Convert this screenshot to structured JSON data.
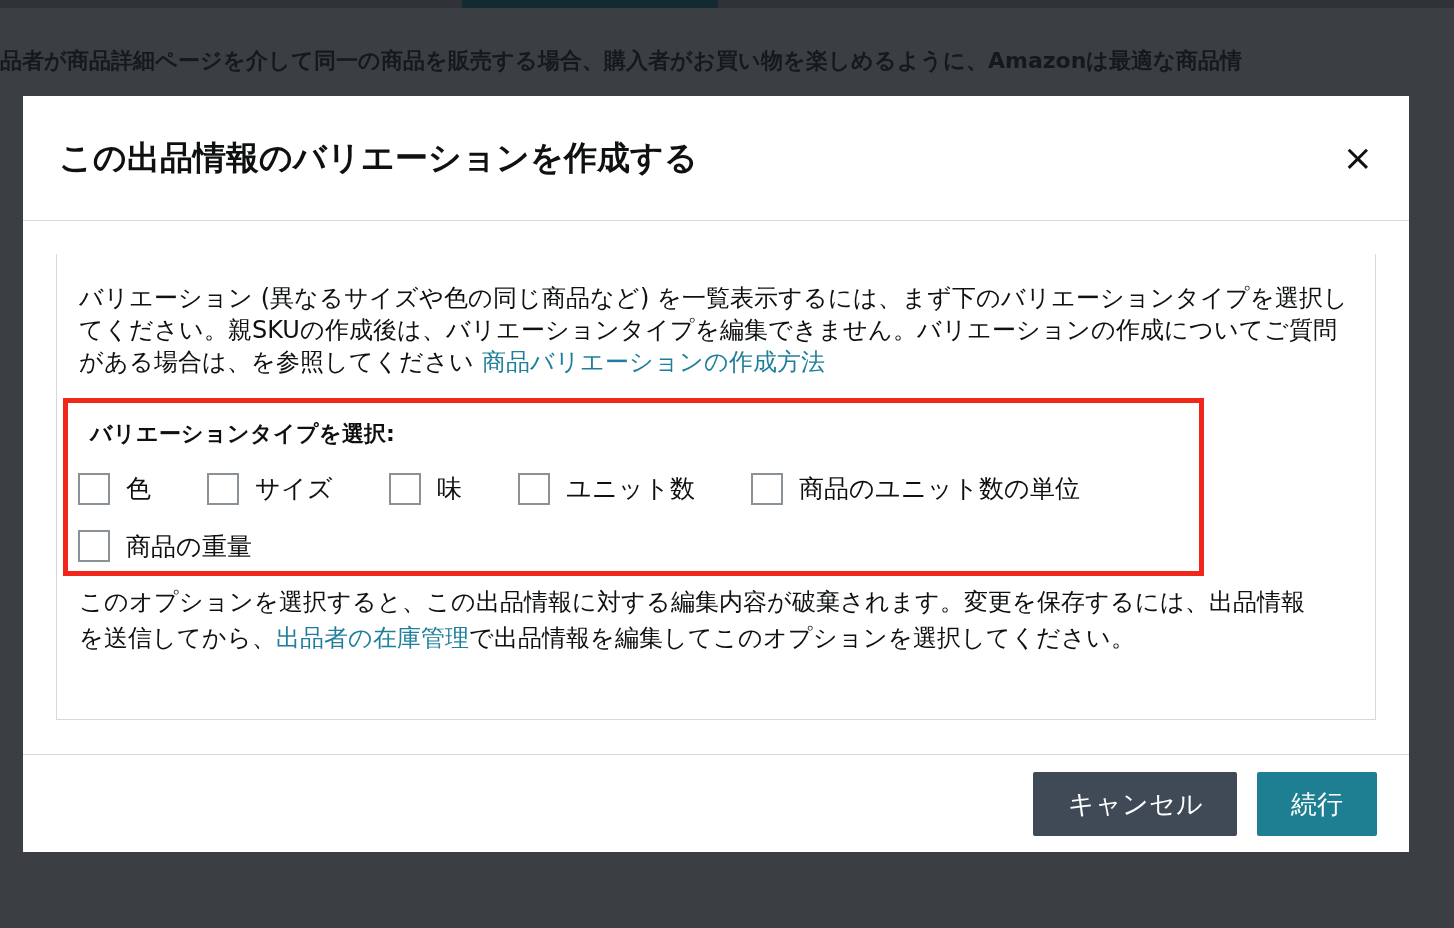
{
  "background": {
    "notice": "品者が商品詳細ページを介して同一の商品を販売する場合、購入者がお買い物を楽しめるように、Amazonは最適な商品情"
  },
  "dialog": {
    "title": "この出品情報のバリエーションを作成する",
    "close": "×",
    "intro": {
      "text": "バリエーション (異なるサイズや色の同じ商品など) を一覧表示するには、まず下のバリエーションタイプを選択してください。親SKUの作成後は、バリエーションタイプを編集できません。バリエーションの作成についてご質問がある場合は、を参照してください",
      "link": "商品バリエーションの作成方法"
    },
    "variation_types": {
      "label": "バリエーションタイプを選択:",
      "options": [
        {
          "label": "色",
          "checked": false
        },
        {
          "label": "サイズ",
          "checked": false
        },
        {
          "label": "味",
          "checked": false
        },
        {
          "label": "ユニット数",
          "checked": false
        },
        {
          "label": "商品のユニット数の単位",
          "checked": false
        },
        {
          "label": "商品の重量",
          "checked": false
        }
      ]
    },
    "warning": {
      "before": "このオプションを選択すると、この出品情報に対する編集内容が破棄されます。変更を保存するには、出品情報を送信してから、",
      "link": "出品者の在庫管理",
      "after": "で出品情報を編集してこのオプションを選択してください。"
    },
    "buttons": {
      "cancel": "キャンセル",
      "continue": "続行"
    }
  }
}
